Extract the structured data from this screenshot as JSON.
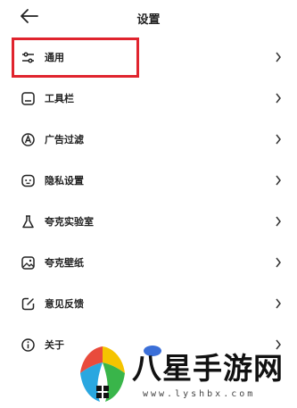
{
  "header": {
    "title": "设置",
    "back_icon": "arrow-left-icon"
  },
  "menu": [
    {
      "label": "通用",
      "icon": "sliders-icon",
      "highlighted": true
    },
    {
      "label": "工具栏",
      "icon": "toolbar-icon"
    },
    {
      "label": "广告过滤",
      "icon": "ad-filter-icon"
    },
    {
      "label": "隐私设置",
      "icon": "privacy-face-icon"
    },
    {
      "label": "夸克实验室",
      "icon": "flask-icon"
    },
    {
      "label": "夸克壁纸",
      "icon": "wallpaper-icon"
    },
    {
      "label": "意见反馈",
      "icon": "feedback-icon"
    },
    {
      "label": "关于",
      "icon": "info-icon"
    }
  ],
  "chevron_icon": "chevron-right-icon",
  "highlight_color": "#e0242e",
  "watermark": {
    "text": "八星手游网",
    "sub": "www.lyshbx.com"
  }
}
